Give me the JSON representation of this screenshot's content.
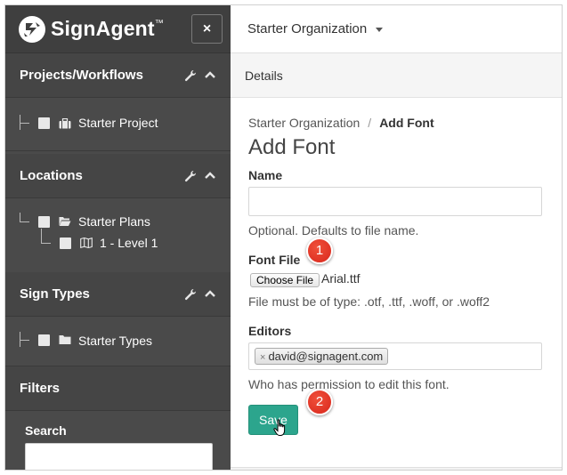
{
  "app": {
    "logo_text": "SignAgent",
    "logo_tm": "™",
    "close_glyph": "×"
  },
  "sidebar": {
    "sections": [
      {
        "title": "Projects/Workflows",
        "items": [
          {
            "label": "Starter Project",
            "icon": "briefcase-icon"
          }
        ]
      },
      {
        "title": "Locations",
        "items": [
          {
            "label": "Starter Plans",
            "icon": "folder-open-icon"
          },
          {
            "label": "1 - Level 1",
            "icon": "map-icon"
          }
        ]
      },
      {
        "title": "Sign Types",
        "items": [
          {
            "label": "Starter Types",
            "icon": "folder-icon"
          }
        ]
      }
    ],
    "filters": {
      "title": "Filters",
      "search_label": "Search"
    }
  },
  "header": {
    "org_name": "Starter Organization"
  },
  "details": {
    "title": "Details"
  },
  "breadcrumb": {
    "parent": "Starter Organization",
    "separator": "/",
    "current": "Add Font"
  },
  "form": {
    "title": "Add Font",
    "name_label": "Name",
    "name_value": "",
    "name_help": "Optional. Defaults to file name.",
    "font_file_label": "Font File",
    "choose_file_label": "Choose File",
    "file_name": "Arial.ttf",
    "file_help": "File must be of type: .otf, .ttf, .woff, or .woff2",
    "editors_label": "Editors",
    "editor_tag": "david@signagent.com",
    "editor_remove": "×",
    "editors_help": "Who has permission to edit this font.",
    "save_label": "Save"
  },
  "callouts": [
    "1",
    "2"
  ],
  "colors": {
    "sidebar_bg": "#4a4a4a",
    "accent": "#2ca58d",
    "callout": "#e0352a"
  }
}
